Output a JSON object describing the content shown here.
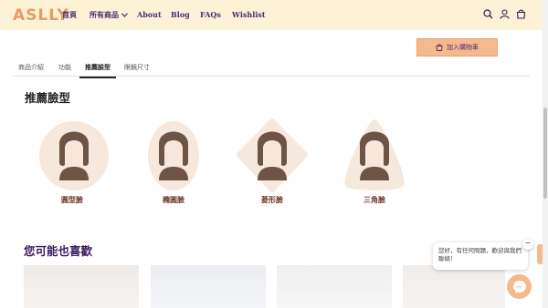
{
  "header": {
    "logo": "ASLLY",
    "nav": [
      {
        "label": "首頁"
      },
      {
        "label": "所有商品",
        "has_dropdown": true
      },
      {
        "label": "About"
      },
      {
        "label": "Blog"
      },
      {
        "label": "FAQs"
      },
      {
        "label": "Wishlist"
      }
    ],
    "icons": [
      "search-icon",
      "account-icon",
      "cart-icon"
    ],
    "background": "#fdf1d6",
    "nav_color": "#4d2a70",
    "logo_color": "#ea9a60"
  },
  "product": {
    "add_to_cart": "加入購物車",
    "button_color": "#f5b98e"
  },
  "tabs": [
    {
      "label": "商品介紹",
      "active": false
    },
    {
      "label": "功能",
      "active": false
    },
    {
      "label": "推薦臉型",
      "active": true
    },
    {
      "label": "眼鏡尺寸",
      "active": false
    }
  ],
  "recommended": {
    "title": "推薦臉型",
    "faces": [
      {
        "label": "圓型臉",
        "shape": "circle"
      },
      {
        "label": "橢圓臉",
        "shape": "oval"
      },
      {
        "label": "菱形臉",
        "shape": "diamond"
      },
      {
        "label": "三角臉",
        "shape": "triangle"
      }
    ],
    "shape_color": "#f6e8dc",
    "hair_color": "#6e5445",
    "skin_color": "#f9e5da"
  },
  "you_may_like": {
    "title": "您可能也喜歡"
  },
  "chat": {
    "message": "您好，有任何問題，歡迎與我們聯絡！",
    "close": "−",
    "icon": "messenger-icon"
  }
}
